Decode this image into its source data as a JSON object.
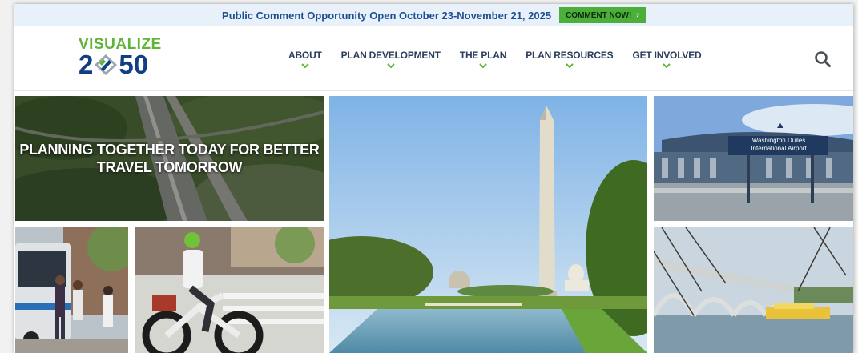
{
  "banner": {
    "text": "Public Comment Opportunity Open October 23-November 21, 2025",
    "button_label": "COMMENT NOW!",
    "button_icon": "chevron-right-icon"
  },
  "logo": {
    "line1": "VISUALIZE",
    "line2_a": "2",
    "line2_b": "50",
    "alt": "Visualize 2050"
  },
  "nav": {
    "items": [
      {
        "label": "ABOUT"
      },
      {
        "label": "PLAN DEVELOPMENT"
      },
      {
        "label": "THE PLAN"
      },
      {
        "label": "PLAN RESOURCES"
      },
      {
        "label": "GET INVOLVED"
      }
    ],
    "dropdown_icon": "chevron-down-icon"
  },
  "search": {
    "icon": "search-icon"
  },
  "hero": {
    "headline_line1": "PLANNING TOGETHER TODAY FOR BETTER",
    "headline_line2": "TRAVEL TOMORROW"
  },
  "tiles": {
    "airport_sign_line1": "Washington Dulles",
    "airport_sign_line2": "International Airport"
  },
  "colors": {
    "brand_green": "#5fb43a",
    "brand_navy": "#123e84",
    "banner_bg": "#e8f1f9",
    "banner_text": "#1d4f91",
    "button_green": "#4caf3a",
    "nav_text": "#2b3e5b"
  }
}
